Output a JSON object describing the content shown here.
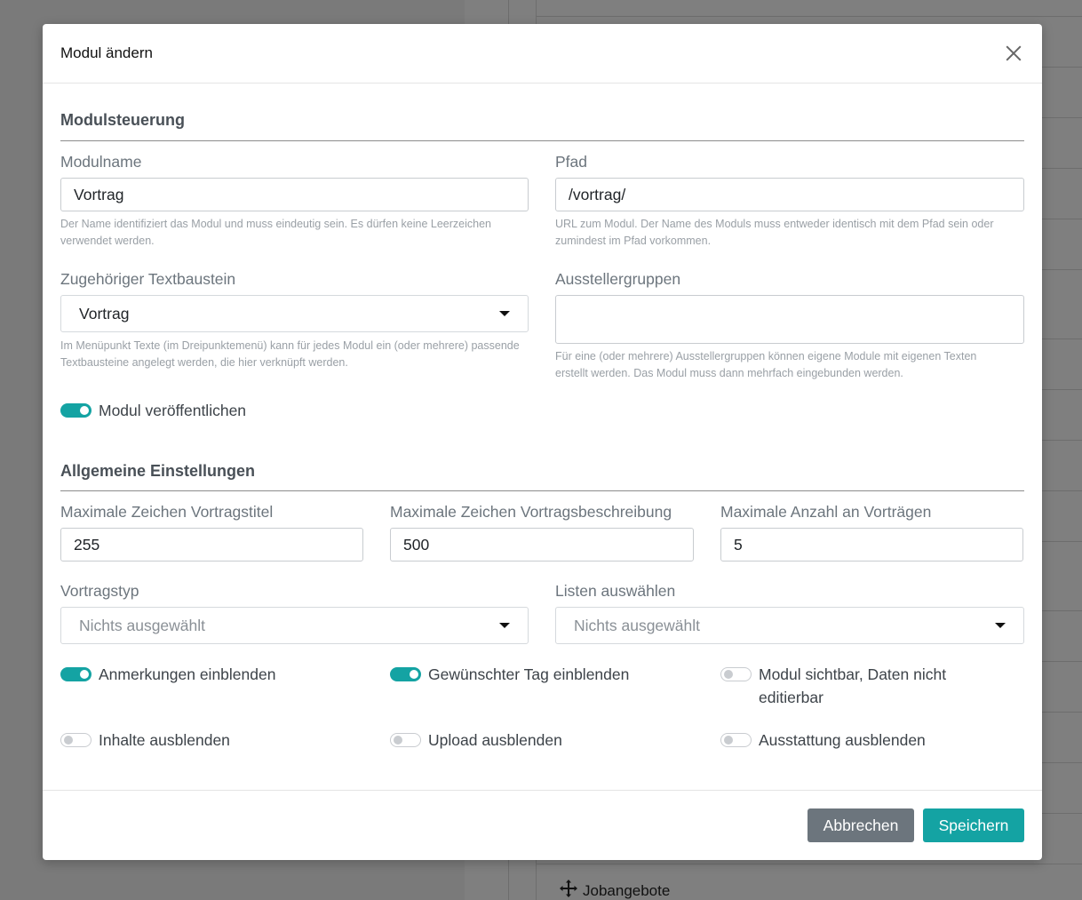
{
  "background": {
    "list_item_label": "Jobangebote",
    "list_item_icon": "move-arrows-icon"
  },
  "modal": {
    "title": "Modul ändern",
    "close_icon": "close-icon"
  },
  "section_module": {
    "title": "Modulsteuerung",
    "module_name": {
      "label": "Modulname",
      "value": "Vortrag",
      "help": "Der Name identifiziert das Modul und muss eindeutig sein. Es dürfen keine Leerzeichen verwendet werden."
    },
    "path": {
      "label": "Pfad",
      "value": "/vortrag/",
      "help": "URL zum Modul. Der Name des Moduls muss entweder identisch mit dem Pfad sein oder zumindest im Pfad vorkommen."
    },
    "text_block": {
      "label": "Zugehöriger Textbaustein",
      "value": "Vortrag",
      "help": "Im Menüpunkt Texte (im Dreipunktemenü) kann für jedes Modul ein (oder mehrere) passende Textbausteine angelegt werden, die hier verknüpft werden."
    },
    "exhibitor_groups": {
      "label": "Ausstellergruppen",
      "value": "",
      "help": "Für eine (oder mehrere) Ausstellergruppen können eigene Module mit eigenen Texten erstellt werden. Das Modul muss dann mehrfach eingebunden werden."
    },
    "publish": {
      "label": "Modul veröffentlichen",
      "on": true
    }
  },
  "section_general": {
    "title": "Allgemeine Einstellungen",
    "max_title_chars": {
      "label": "Maximale Zeichen Vortragstitel",
      "value": "255"
    },
    "max_desc_chars": {
      "label": "Maximale Zeichen Vortragsbeschreibung",
      "value": "500"
    },
    "max_talks": {
      "label": "Maximale Anzahl an Vorträgen",
      "value": "5"
    },
    "talk_type": {
      "label": "Vortragstyp",
      "placeholder": "Nichts ausgewählt"
    },
    "lists": {
      "label": "Listen auswählen",
      "placeholder": "Nichts ausgewählt"
    },
    "toggles": [
      {
        "label": "Anmerkungen einblenden",
        "on": true
      },
      {
        "label": "Gewünschter Tag einblenden",
        "on": true
      },
      {
        "label": "Modul sichtbar, Daten nicht editierbar",
        "on": false
      },
      {
        "label": "Inhalte ausblenden",
        "on": false
      },
      {
        "label": "Upload ausblenden",
        "on": false
      },
      {
        "label": "Ausstattung ausblenden",
        "on": false
      }
    ]
  },
  "footer": {
    "cancel_label": "Abbrechen",
    "save_label": "Speichern"
  },
  "colors": {
    "accent": "#14a3a3",
    "secondary": "#6c757d"
  }
}
